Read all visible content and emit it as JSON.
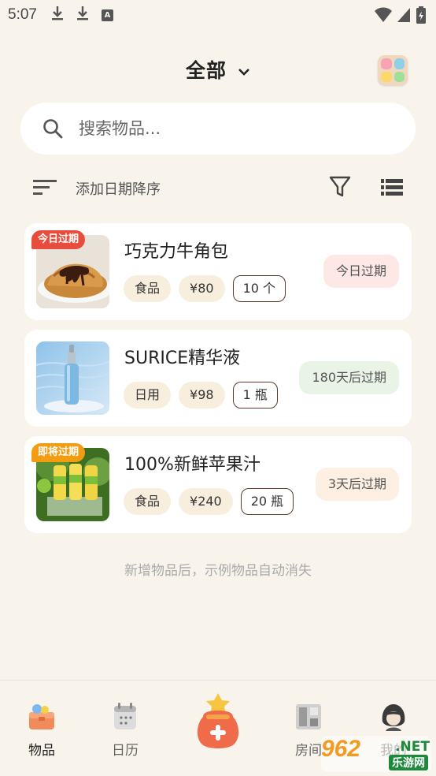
{
  "status_bar": {
    "time": "5:07",
    "a_label": "A"
  },
  "header": {
    "title": "全部"
  },
  "search": {
    "placeholder": "搜索物品..."
  },
  "sort": {
    "label": "添加日期降序"
  },
  "items": [
    {
      "name": "巧克力牛角包",
      "ribbon": "今日过期",
      "category": "食品",
      "price": "¥80",
      "quantity": "10 个",
      "status": "今日过期",
      "status_bg": "#fde8e6",
      "ribbon_color": "#e74c3c"
    },
    {
      "name": "SURICE精华液",
      "ribbon": "",
      "category": "日用",
      "price": "¥98",
      "quantity": "1 瓶",
      "status": "180天后过期",
      "status_bg": "#e9f3e6",
      "ribbon_color": ""
    },
    {
      "name": "100%新鲜苹果汁",
      "ribbon": "即将过期",
      "category": "食品",
      "price": "¥240",
      "quantity": "20 瓶",
      "status": "3天后过期",
      "status_bg": "#fdf0e2",
      "ribbon_color": "#f39c12"
    }
  ],
  "hint": "新增物品后，示例物品自动消失",
  "nav": {
    "items_label": "物品",
    "calendar_label": "日历",
    "rooms_label": "房间",
    "me_label": "我的"
  },
  "watermark": {
    "number": "962",
    "net": ".NET",
    "cn": "乐游网"
  }
}
